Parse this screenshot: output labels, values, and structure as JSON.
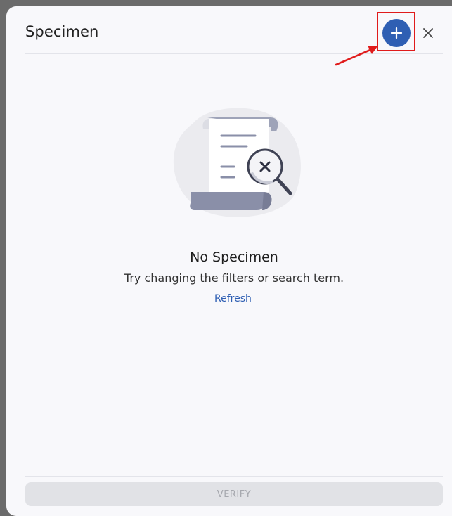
{
  "header": {
    "title": "Specimen",
    "add_icon": "plus-icon",
    "close_icon": "close-icon"
  },
  "empty_state": {
    "illustration_icon": "document-search-empty-icon",
    "title": "No Specimen",
    "subtitle": "Try changing the filters or search term.",
    "refresh_label": "Refresh"
  },
  "footer": {
    "verify_label": "VERIFY",
    "verify_disabled": true
  },
  "annotation": {
    "highlight_color": "#e01b1b",
    "arrow_color": "#e01b1b"
  },
  "colors": {
    "accent": "#2f5fb3",
    "panel_bg": "#f8f8fb"
  }
}
